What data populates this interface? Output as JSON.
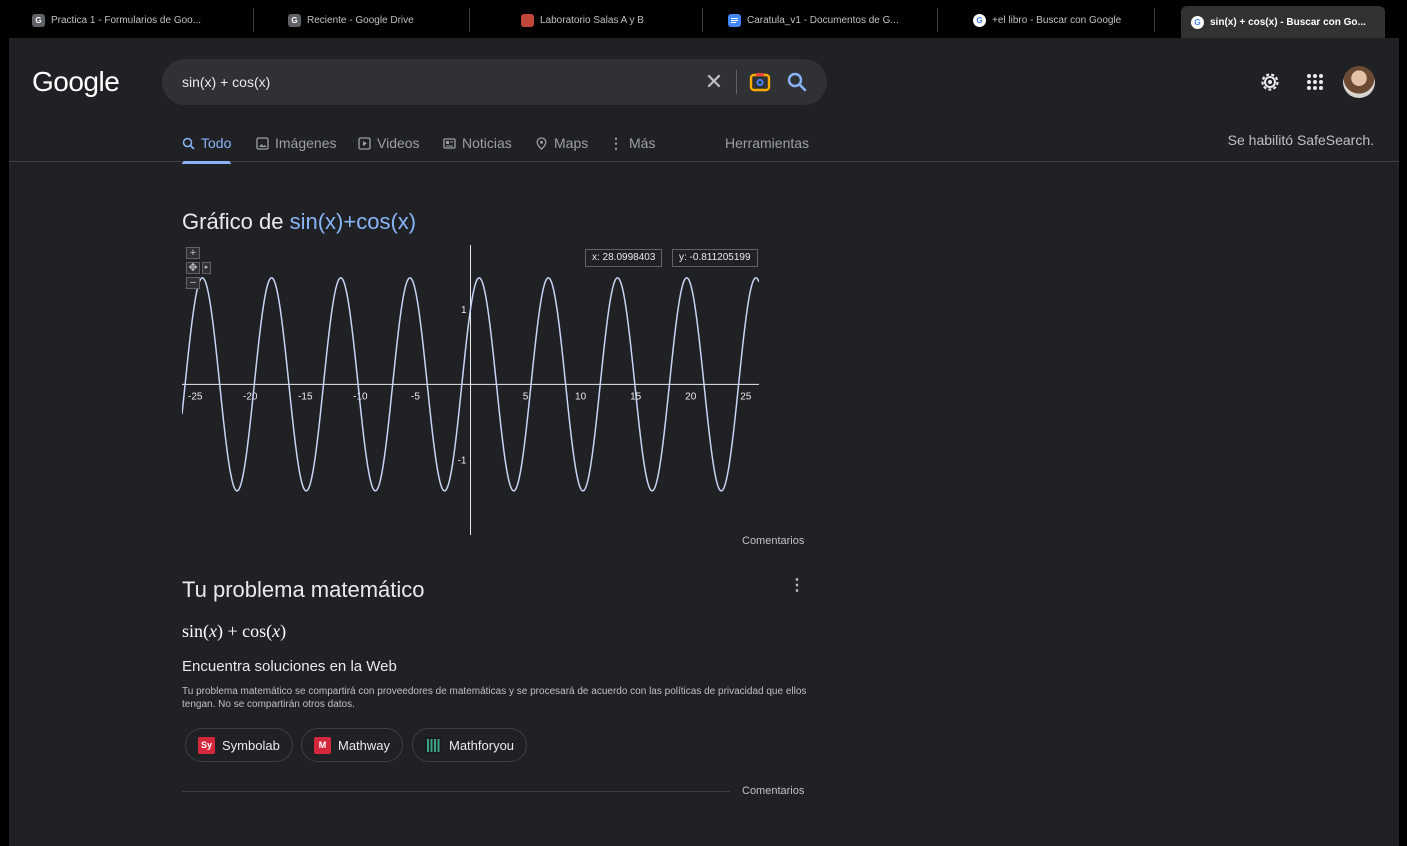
{
  "tabs": [
    {
      "title": "Practica 1 - Formularios de Goo...",
      "favicon": "G",
      "favicon_bg": "#5f6368",
      "active": false
    },
    {
      "title": "Reciente - Google Drive",
      "favicon": "G",
      "favicon_bg": "#5f6368",
      "active": false
    },
    {
      "title": "Laboratorio Salas A y B",
      "favicon": "",
      "favicon_bg": "#c2473b",
      "active": false
    },
    {
      "title": "Caratula_v1 - Documentos de G...",
      "favicon": "",
      "favicon_bg": "#4285f4",
      "active": false
    },
    {
      "title": "+el libro - Buscar con Google",
      "favicon": "G",
      "favicon_bg": "#ffffff",
      "active": false
    },
    {
      "title": "sin(x) + cos(x) - Buscar con Go...",
      "favicon": "G",
      "favicon_bg": "#ffffff",
      "active": true
    }
  ],
  "header": {
    "logo": "Google",
    "search_value": "sin(x) + cos(x)",
    "icons": [
      "clear-icon",
      "lens-icon",
      "search-icon",
      "settings-icon",
      "apps-icon",
      "avatar"
    ]
  },
  "nav": {
    "items": [
      "Todo",
      "Imágenes",
      "Videos",
      "Noticias",
      "Maps",
      "Más"
    ],
    "tools": "Herramientas",
    "safesearch": "Se habilitó SafeSearch."
  },
  "graph": {
    "title_prefix": "Gráfico de ",
    "title_fn": "sin(x)+cos(x)",
    "readout_x": "x: 28.0998403",
    "readout_y": "y: -0.811205199",
    "feedback": "Comentarios",
    "chart_data": {
      "type": "line",
      "function": "sin(x)+cos(x)",
      "x_ticks": [
        -25,
        -20,
        -15,
        -10,
        -5,
        5,
        10,
        15,
        20,
        25
      ],
      "y_ticks": [
        1,
        -1
      ],
      "xlim": [
        -26.2,
        26.2
      ],
      "ylim": [
        -2.0,
        1.85
      ],
      "grid": false
    }
  },
  "math": {
    "title": "Tu problema matemático",
    "expression_parts": [
      "sin(",
      "x",
      ") + cos(",
      "x",
      ")"
    ],
    "find_title": "Encuentra soluciones en la Web",
    "disclaimer": "Tu problema matemático se compartirá con proveedores de matemáticas y se procesará de acuerdo con las políticas de privacidad que ellos tengan. No se compartirán otros datos.",
    "providers": [
      {
        "name": "Symbolab",
        "logo": "Sy",
        "color": "#d3283b"
      },
      {
        "name": "Mathway",
        "logo": "M",
        "color": "#d3283b"
      },
      {
        "name": "Mathforyou",
        "logo": "",
        "color": "#3ba58a"
      }
    ],
    "feedback": "Comentarios"
  },
  "colors": {
    "accent": "#8ab4f8",
    "background": "#202124",
    "curve": "#c8d4f5"
  }
}
